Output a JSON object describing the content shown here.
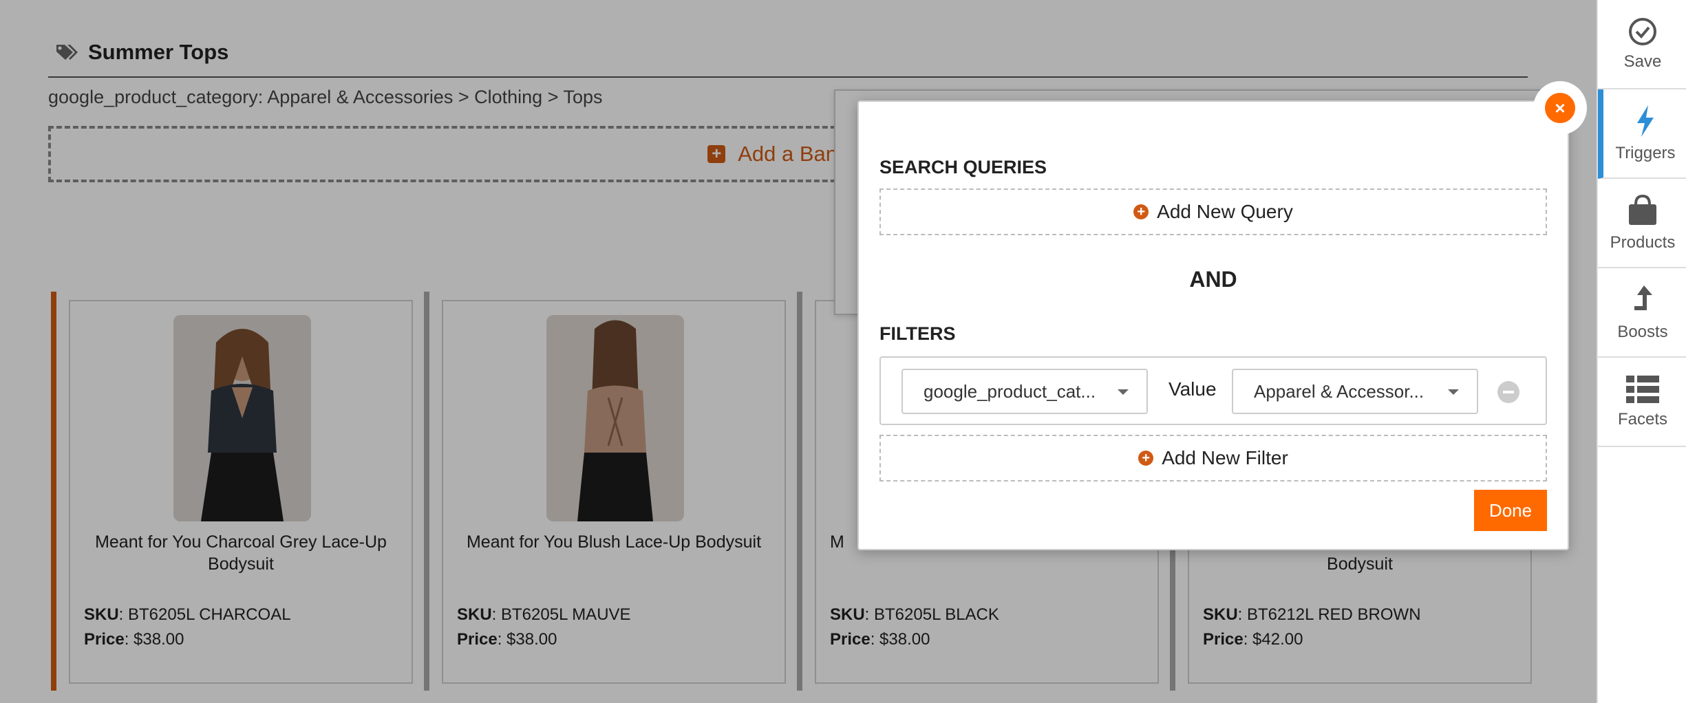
{
  "page": {
    "title": "Summer Tops",
    "category_line": "google_product_category: Apparel & Accessories > Clothing > Tops",
    "banner_label": "Add a Banner"
  },
  "sidebar": {
    "items": [
      {
        "label": "Save",
        "icon": "check-circle-icon"
      },
      {
        "label": "Triggers",
        "icon": "lightning-icon"
      },
      {
        "label": "Products",
        "icon": "shopping-bag-icon"
      },
      {
        "label": "Boosts",
        "icon": "arrow-up-icon"
      },
      {
        "label": "Facets",
        "icon": "list-icon"
      }
    ],
    "active": "Triggers",
    "active_color": "#2c8ed6"
  },
  "products": [
    {
      "name": "Meant for You Charcoal Grey Lace-Up Bodysuit",
      "sku_label": "SKU",
      "sku": ": BT6205L CHARCOAL",
      "price_label": "Price",
      "price": ": $38.00"
    },
    {
      "name": "Meant for You Blush Lace-Up Bodysuit",
      "sku_label": "SKU",
      "sku": ": BT6205L MAUVE",
      "price_label": "Price",
      "price": ": $38.00"
    },
    {
      "name": "M",
      "sku_label": "SKU",
      "sku": ": BT6205L BLACK",
      "price_label": "Price",
      "price": ": $38.00"
    },
    {
      "name": "Bodysuit",
      "sku_label": "SKU",
      "sku": ": BT6212L RED BROWN",
      "price_label": "Price",
      "price": ": $42.00"
    }
  ],
  "modal": {
    "search_queries_title": "SEARCH QUERIES",
    "add_query_label": "Add New Query",
    "and_label": "AND",
    "filters_title": "FILTERS",
    "filter": {
      "field": "google_product_cat...",
      "value_label": "Value",
      "value": "Apparel & Accessor..."
    },
    "add_filter_label": "Add New Filter",
    "done_label": "Done",
    "close_label": "×"
  },
  "colors": {
    "accent_orange": "#ff6a00",
    "brand_orange": "#d05a14",
    "sidebar_active": "#2c8ed6"
  }
}
